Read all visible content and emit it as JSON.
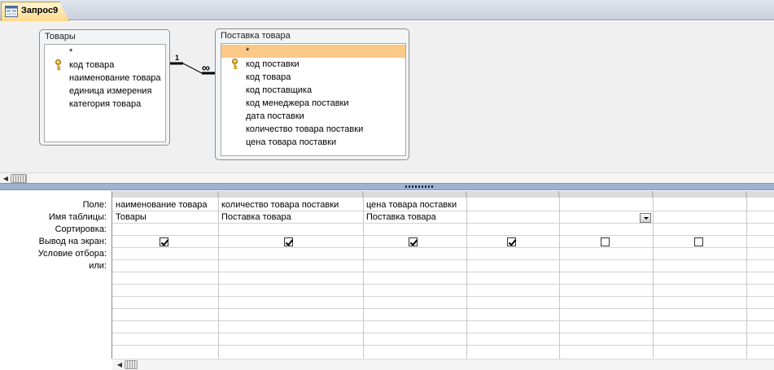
{
  "tab": {
    "title": "Запрос9"
  },
  "tables": [
    {
      "title": "Товары",
      "fields": [
        {
          "name": "*",
          "key": false,
          "selected": false
        },
        {
          "name": "код товара",
          "key": true,
          "selected": false
        },
        {
          "name": "наименование товара",
          "key": false,
          "selected": false
        },
        {
          "name": "единица измерения",
          "key": false,
          "selected": false
        },
        {
          "name": "категория товара",
          "key": false,
          "selected": false
        }
      ]
    },
    {
      "title": "Поставка товара",
      "fields": [
        {
          "name": "*",
          "key": false,
          "selected": true
        },
        {
          "name": "код поставки",
          "key": true,
          "selected": false
        },
        {
          "name": "код товара",
          "key": false,
          "selected": false
        },
        {
          "name": "код поставщика",
          "key": false,
          "selected": false
        },
        {
          "name": "код менеджера поставки",
          "key": false,
          "selected": false
        },
        {
          "name": "дата поставки",
          "key": false,
          "selected": false
        },
        {
          "name": "количество товара поставки",
          "key": false,
          "selected": false
        },
        {
          "name": "цена товара поставки",
          "key": false,
          "selected": false
        }
      ]
    }
  ],
  "relationship": {
    "one_label": "1",
    "many_label": "∞"
  },
  "grid": {
    "row_labels": {
      "field": "Поле:",
      "table": "Имя таблицы:",
      "sort": "Сортировка:",
      "show": "Вывод на экран:",
      "criteria": "Условие отбора:",
      "or": "или:"
    },
    "columns": [
      {
        "field": "наименование товара",
        "table": "Товары",
        "show": true
      },
      {
        "field": "количество товара поставки",
        "table": "Поставка товара",
        "show": true
      },
      {
        "field": "цена товара поставки",
        "table": "Поставка товара",
        "show": true
      },
      {
        "field": "",
        "table": "",
        "show": true
      },
      {
        "field": "",
        "table": "",
        "show": false
      },
      {
        "field": "",
        "table": "",
        "show": false
      },
      {
        "field": "",
        "table": "",
        "show": null
      }
    ]
  },
  "colors": {
    "selected_field": "#f9c985",
    "splitter": "#9eb3d0",
    "tab_active": "#ffd98a"
  }
}
